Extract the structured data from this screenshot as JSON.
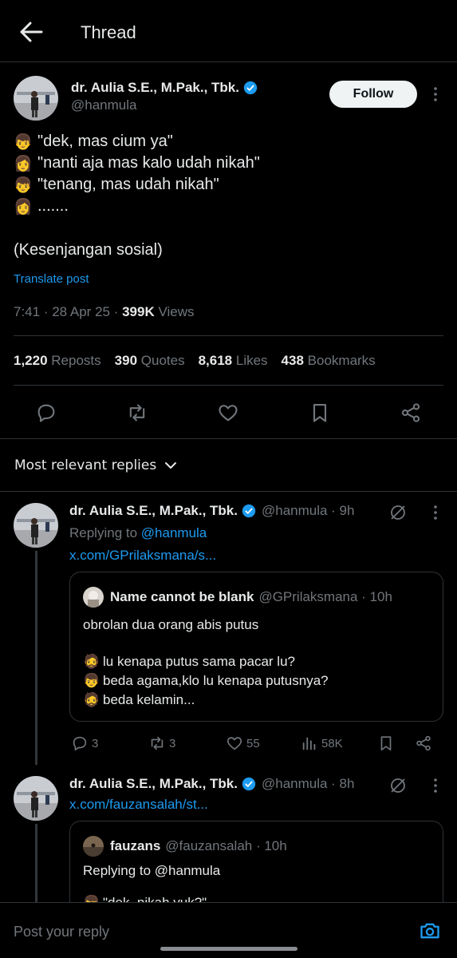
{
  "header": {
    "title": "Thread"
  },
  "post": {
    "author_name": "dr. Aulia S.E., M.Pak., Tbk.",
    "handle": "@hanmula",
    "follow_label": "Follow",
    "lines": [
      {
        "emoji": "👦",
        "text": "\"dek, mas cium ya\""
      },
      {
        "emoji": "👩",
        "text": "\"nanti aja mas kalo udah nikah\""
      },
      {
        "emoji": "👦",
        "text": "\"tenang, mas udah nikah\""
      },
      {
        "emoji": "👩",
        "text": "......."
      }
    ],
    "closing": "(Kesenjangan sosial)",
    "translate": "Translate post",
    "time": "7:41 · 28 Apr 25 · ",
    "views_count": "399K",
    "views_label": " Views",
    "stats": [
      {
        "count": "1,220",
        "label": "Reposts"
      },
      {
        "count": "390",
        "label": "Quotes"
      },
      {
        "count": "8,618",
        "label": "Likes"
      },
      {
        "count": "438",
        "label": "Bookmarks"
      }
    ]
  },
  "replies_header": {
    "label": "Most relevant replies"
  },
  "reply1": {
    "author_name": "dr. Aulia S.E., M.Pak., Tbk.",
    "handle_time": "@hanmula · 9h",
    "replying_to_prefix": "Replying to ",
    "replying_to_handle": "@hanmula",
    "link": "x.com/GPrilaksmana/s...",
    "quote": {
      "name": "Name cannot be blank",
      "handle_time": "@GPrilaksmana · 10h",
      "intro": "obrolan dua orang abis putus",
      "lines": [
        {
          "emoji": "🧔",
          "text": "lu kenapa putus sama pacar lu?"
        },
        {
          "emoji": "👦",
          "text": "beda agama,klo lu kenapa putusnya?"
        },
        {
          "emoji": "🧔",
          "text": "beda kelamin..."
        }
      ]
    },
    "actions": {
      "replies": "3",
      "reposts": "3",
      "likes": "55",
      "views": "58K"
    }
  },
  "reply2": {
    "author_name": "dr. Aulia S.E., M.Pak., Tbk.",
    "handle_time": "@hanmula · 8h",
    "link": "x.com/fauzansalah/st...",
    "quote": {
      "name": "fauzans",
      "handle_time": "@fauzansalah · 10h",
      "replying": "Replying to @hanmula",
      "partial": "\"dek, nikah yuk?\""
    }
  },
  "composer": {
    "placeholder": "Post your reply"
  },
  "colors": {
    "accent": "#1d9bf0",
    "background": "#000000",
    "divider": "#2f3336",
    "muted": "#71767b"
  }
}
